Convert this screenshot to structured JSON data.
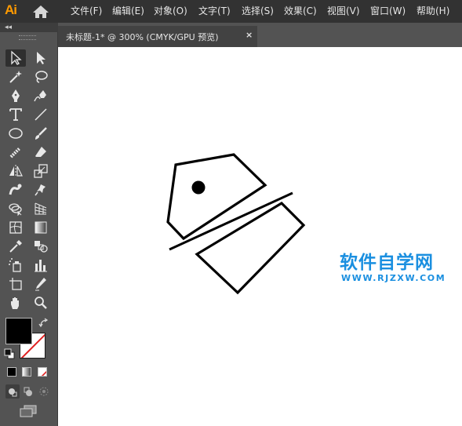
{
  "app": {
    "logo_text": "Ai",
    "colors": {
      "menubar": "#323232",
      "workspace": "#535353",
      "accent_logo": "#ff9a00",
      "watermark": "#1a8fe0"
    }
  },
  "menu": {
    "items": [
      "文件(F)",
      "编辑(E)",
      "对象(O)",
      "文字(T)",
      "选择(S)",
      "效果(C)",
      "视图(V)",
      "窗口(W)",
      "帮助(H)"
    ]
  },
  "panel": {
    "collapse_glyph": "◂◂"
  },
  "document_tab": {
    "title": "未标题-1* @ 300% (CMYK/GPU 预览)",
    "close_glyph": "×"
  },
  "toolbar": {
    "tools": [
      "selection-tool",
      "direct-selection-tool",
      "magic-wand-tool",
      "lasso-tool",
      "pen-tool",
      "curvature-tool",
      "type-tool",
      "line-segment-tool",
      "ellipse-tool",
      "paintbrush-tool",
      "shaper-tool",
      "eraser-tool",
      "reflect-tool",
      "scale-tool",
      "warp-tool",
      "puppet-warp-tool",
      "shape-builder-tool",
      "perspective-grid-tool",
      "mesh-tool",
      "gradient-tool",
      "eyedropper-tool",
      "blend-tool",
      "symbol-sprayer-tool",
      "column-graph-tool",
      "artboard-tool",
      "slice-tool",
      "hand-tool",
      "zoom-tool"
    ],
    "fill_color": "#000000",
    "stroke_color": "none"
  },
  "watermark": {
    "title": "软件自学网",
    "url": "WWW.RJZXW.COM"
  }
}
